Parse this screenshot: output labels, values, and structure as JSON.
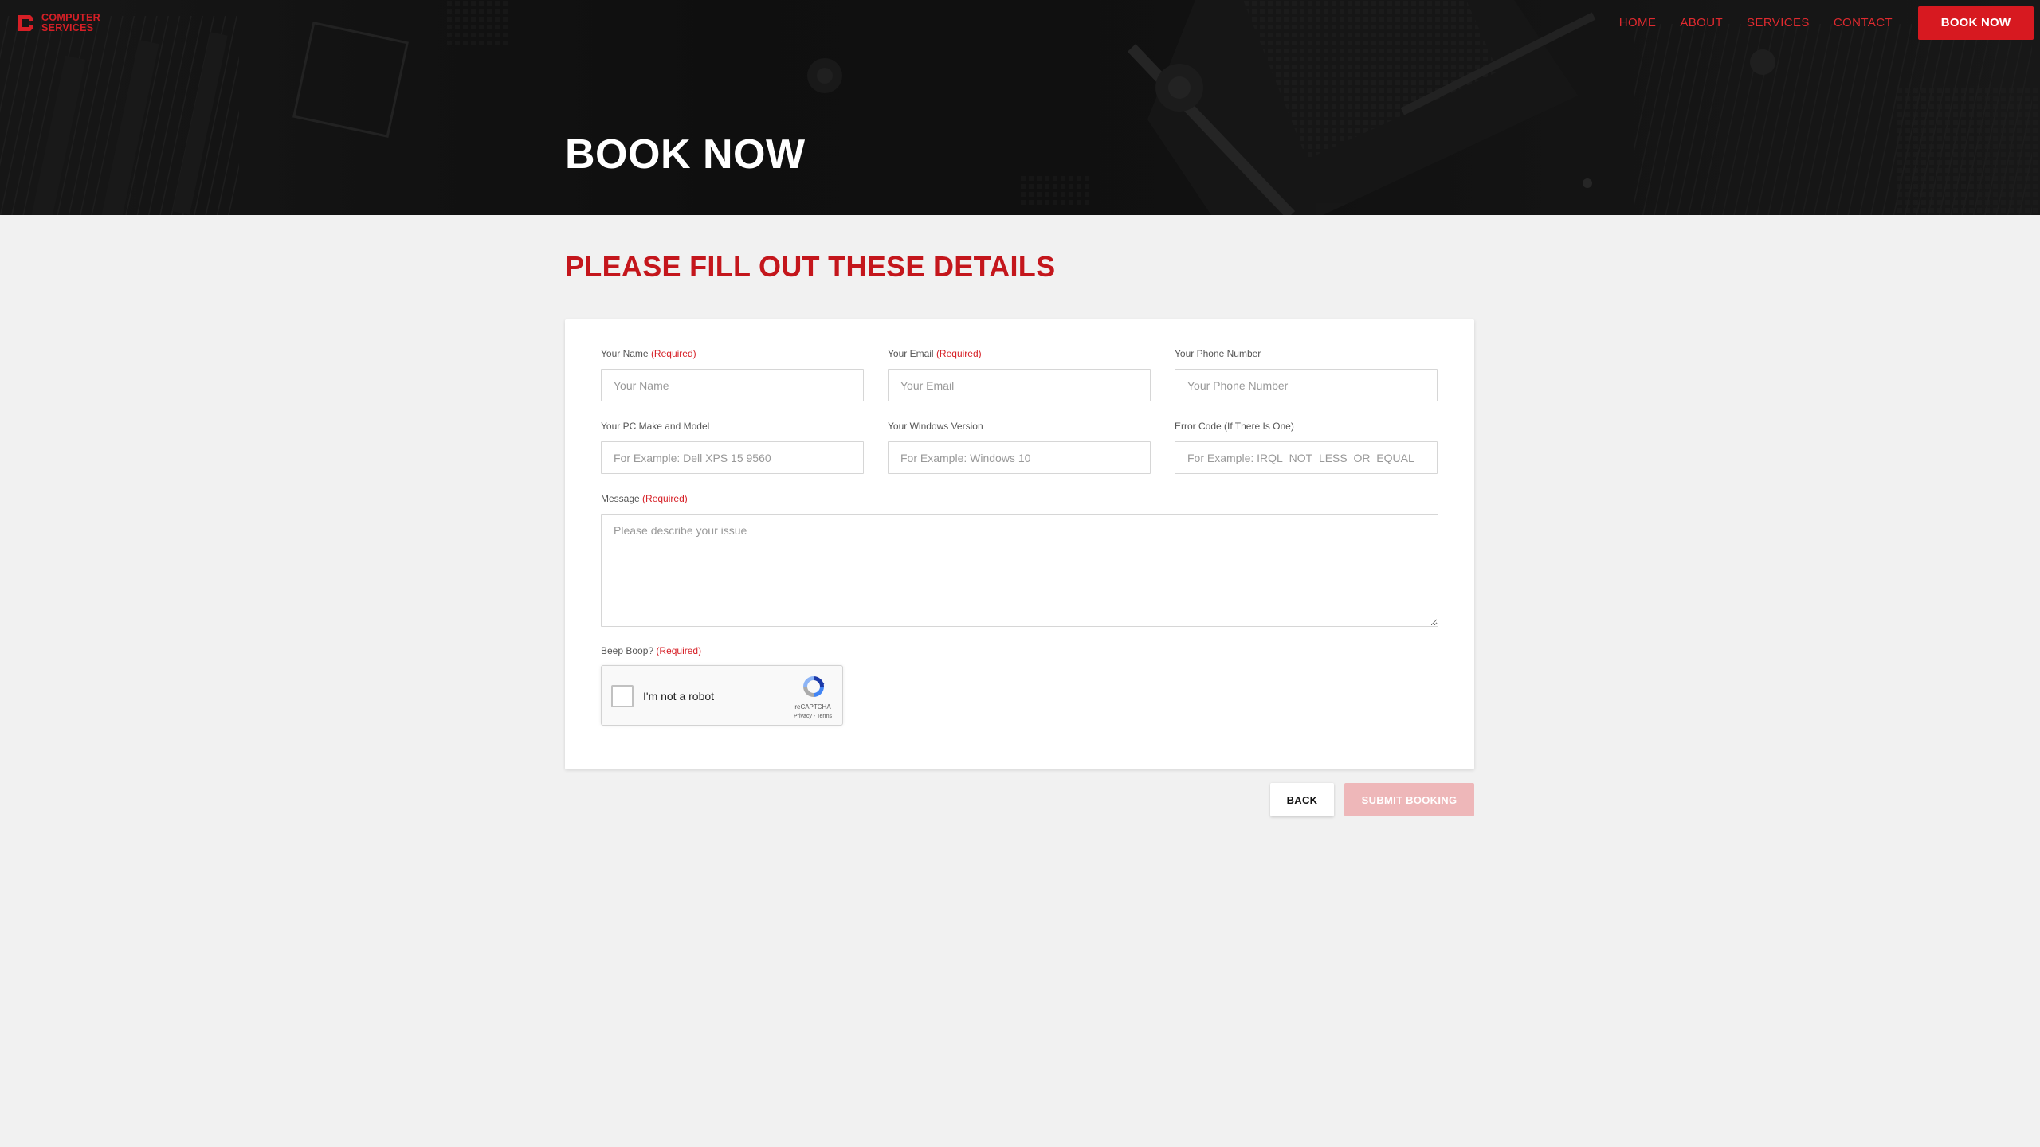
{
  "brand": {
    "line1": "COMPUTER",
    "line2": "SERVICES",
    "accent_color": "#d61f26"
  },
  "nav": {
    "items": [
      {
        "label": "HOME"
      },
      {
        "label": "ABOUT"
      },
      {
        "label": "SERVICES"
      },
      {
        "label": "CONTACT"
      }
    ],
    "cta_label": "BOOK NOW"
  },
  "hero": {
    "title": "BOOK NOW"
  },
  "form": {
    "heading": "PLEASE FILL OUT THESE DETAILS",
    "required_tag": "(Required)",
    "fields": {
      "name": {
        "label": "Your Name",
        "placeholder": "Your Name",
        "value": ""
      },
      "email": {
        "label": "Your Email",
        "placeholder": "Your Email",
        "value": ""
      },
      "phone": {
        "label": "Your Phone Number",
        "placeholder": "Your Phone Number",
        "value": ""
      },
      "pc_model": {
        "label": "Your PC Make and Model",
        "placeholder": "For Example: Dell XPS 15 9560",
        "value": ""
      },
      "windows_version": {
        "label": "Your Windows Version",
        "placeholder": "For Example: Windows 10",
        "value": ""
      },
      "error_code": {
        "label": "Error Code (If There Is One)",
        "placeholder": "For Example: IRQL_NOT_LESS_OR_EQUAL",
        "value": ""
      },
      "message": {
        "label": "Message",
        "placeholder": "Please describe your issue",
        "value": ""
      },
      "captcha": {
        "label": "Beep Boop?"
      }
    },
    "recaptcha": {
      "text": "I'm not a robot",
      "brand": "reCAPTCHA",
      "links": "Privacy - Terms",
      "checked": false
    },
    "buttons": {
      "back": "BACK",
      "submit": "SUBMIT BOOKING",
      "submit_disabled": true
    }
  }
}
